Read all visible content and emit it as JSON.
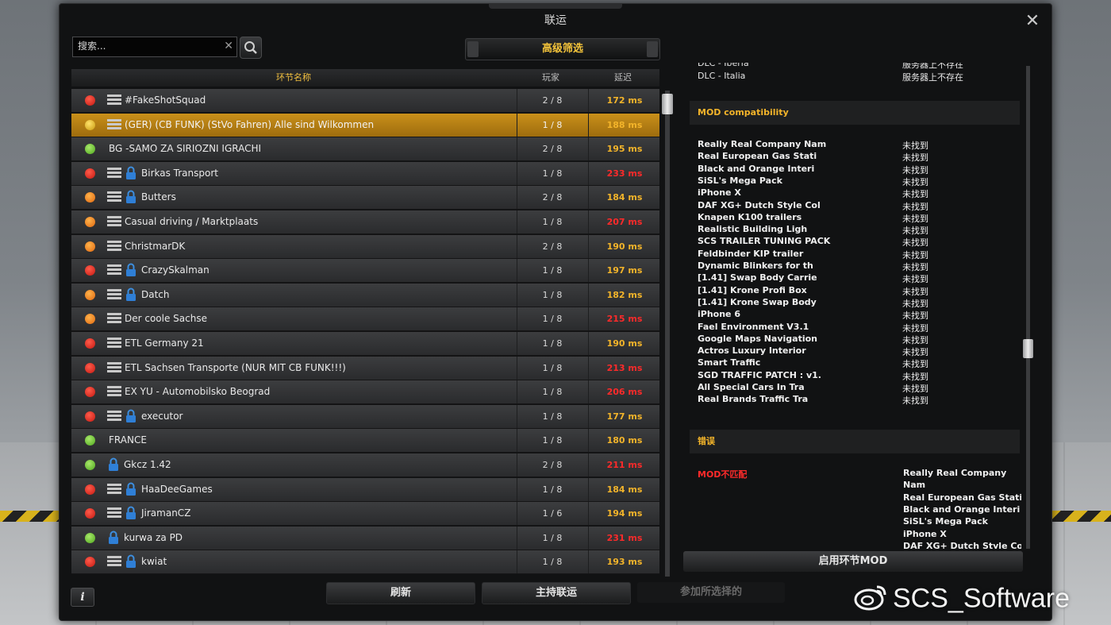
{
  "window": {
    "title": "联运"
  },
  "search": {
    "placeholder": "搜索..."
  },
  "filter": {
    "advanced_label": "高级筛选"
  },
  "list": {
    "headers": {
      "name": "环节名称",
      "players": "玩家",
      "ping": "延迟"
    },
    "rows": [
      {
        "status": "red",
        "icon": "server",
        "locked": false,
        "name": "#FakeShotSquad",
        "players": "2 / 8",
        "ping": "172 ms",
        "ping_level": "warn"
      },
      {
        "status": "yellow",
        "icon": "server",
        "locked": false,
        "name": "(GER) (CB FUNK) (StVo Fahren) Alle sind Wilkommen",
        "players": "1 / 8",
        "ping": "188 ms",
        "ping_level": "warn",
        "selected": true
      },
      {
        "status": "green",
        "icon": "none",
        "locked": false,
        "name": "BG -SAMO ZA SIRIOZNI IGRACHI",
        "players": "2 / 8",
        "ping": "195 ms",
        "ping_level": "warn"
      },
      {
        "status": "red",
        "icon": "server",
        "locked": true,
        "name": "Birkas Transport",
        "players": "1 / 8",
        "ping": "233 ms",
        "ping_level": "bad"
      },
      {
        "status": "orange",
        "icon": "server",
        "locked": true,
        "name": "Butters",
        "players": "2 / 8",
        "ping": "184 ms",
        "ping_level": "warn"
      },
      {
        "status": "orange",
        "icon": "server",
        "locked": false,
        "name": "Casual driving / Marktplaats",
        "players": "1 / 8",
        "ping": "207 ms",
        "ping_level": "bad"
      },
      {
        "status": "orange",
        "icon": "server",
        "locked": false,
        "name": "ChristmarDK",
        "players": "2 / 8",
        "ping": "190 ms",
        "ping_level": "warn"
      },
      {
        "status": "red",
        "icon": "server",
        "locked": true,
        "name": "CrazySkalman",
        "players": "1 / 8",
        "ping": "197 ms",
        "ping_level": "warn"
      },
      {
        "status": "orange",
        "icon": "server",
        "locked": true,
        "name": "Datch",
        "players": "1 / 8",
        "ping": "182 ms",
        "ping_level": "warn"
      },
      {
        "status": "orange",
        "icon": "server",
        "locked": false,
        "name": "Der coole Sachse",
        "players": "1 / 8",
        "ping": "215 ms",
        "ping_level": "bad"
      },
      {
        "status": "red",
        "icon": "server",
        "locked": false,
        "name": "ETL Germany 21",
        "players": "1 / 8",
        "ping": "190 ms",
        "ping_level": "warn"
      },
      {
        "status": "red",
        "icon": "server",
        "locked": false,
        "name": "ETL Sachsen Transporte (NUR MIT CB FUNK!!!)",
        "players": "1 / 8",
        "ping": "213 ms",
        "ping_level": "bad"
      },
      {
        "status": "red",
        "icon": "server",
        "locked": false,
        "name": "EX YU - Automobilsko Beograd",
        "players": "1 / 8",
        "ping": "206 ms",
        "ping_level": "bad"
      },
      {
        "status": "red",
        "icon": "server",
        "locked": true,
        "name": "executor",
        "players": "1 / 8",
        "ping": "177 ms",
        "ping_level": "warn"
      },
      {
        "status": "green",
        "icon": "none",
        "locked": false,
        "name": "FRANCE",
        "players": "1 / 8",
        "ping": "180 ms",
        "ping_level": "warn"
      },
      {
        "status": "green",
        "icon": "none",
        "locked": true,
        "name": "Gkcz 1.42",
        "players": "2 / 8",
        "ping": "211 ms",
        "ping_level": "bad"
      },
      {
        "status": "red",
        "icon": "server",
        "locked": true,
        "name": "HaaDeeGames",
        "players": "1 / 8",
        "ping": "184 ms",
        "ping_level": "warn"
      },
      {
        "status": "red",
        "icon": "server",
        "locked": true,
        "name": "JiramanCZ",
        "players": "1 / 6",
        "ping": "194 ms",
        "ping_level": "warn"
      },
      {
        "status": "green",
        "icon": "none",
        "locked": true,
        "name": "kurwa za PD",
        "players": "1 / 8",
        "ping": "231 ms",
        "ping_level": "bad"
      },
      {
        "status": "red",
        "icon": "server",
        "locked": true,
        "name": "kwiat",
        "players": "1 / 8",
        "ping": "193 ms",
        "ping_level": "warn"
      }
    ]
  },
  "details": {
    "dlc_rows": [
      {
        "name": "DLC - Iberia",
        "status": "服务器上不存在"
      },
      {
        "name": "DLC - Italia",
        "status": "服务器上不存在"
      }
    ],
    "mod_section_title": "MOD compatibility",
    "mods": [
      {
        "name": "Really Real Company Nam",
        "status": "未找到"
      },
      {
        "name": "Real European Gas Stati",
        "status": "未找到"
      },
      {
        "name": "Black and Orange Interi",
        "status": "未找到"
      },
      {
        "name": "SiSL's Mega Pack",
        "status": "未找到"
      },
      {
        "name": "iPhone X",
        "status": "未找到"
      },
      {
        "name": "DAF XG+ Dutch Style Col",
        "status": "未找到"
      },
      {
        "name": "Knapen K100 trailers",
        "status": "未找到"
      },
      {
        "name": "Realistic Building Ligh",
        "status": "未找到"
      },
      {
        "name": "SCS TRAILER TUNING PACK",
        "status": "未找到"
      },
      {
        "name": "Feldbinder KIP trailer",
        "status": "未找到"
      },
      {
        "name": "Dynamic Blinkers for th",
        "status": "未找到"
      },
      {
        "name": "[1.41] Swap Body Carrie",
        "status": "未找到"
      },
      {
        "name": "[1.41] Krone Profi Box",
        "status": "未找到"
      },
      {
        "name": "[1.41] Krone Swap Body",
        "status": "未找到"
      },
      {
        "name": "iPhone 6",
        "status": "未找到"
      },
      {
        "name": "Fael Environment V3.1",
        "status": "未找到"
      },
      {
        "name": "Google Maps Navigation",
        "status": "未找到"
      },
      {
        "name": "Actros Luxury Interior",
        "status": "未找到"
      },
      {
        "name": "Smart Traffic",
        "status": "未找到"
      },
      {
        "name": "SGD TRAFFIC PATCH : v1.",
        "status": "未找到"
      },
      {
        "name": "All Special Cars In Tra",
        "status": "未找到"
      },
      {
        "name": "Real Brands Traffic Tra",
        "status": "未找到"
      }
    ],
    "error_section_title": "错误",
    "error_label": "MOD不匹配",
    "error_items": [
      "Really Real Company",
      "Nam",
      "Real European Gas Stati",
      "Black and Orange Interi",
      "SiSL's Mega Pack",
      "iPhone X",
      "DAF XG+ Dutch Style Col"
    ],
    "enable_mods_label": "启用环节MOD"
  },
  "bottom": {
    "info_label": "i",
    "refresh_label": "刷新",
    "host_label": "主持联运",
    "join_label": "参加所选择的"
  },
  "watermark": {
    "text": "SCS_Software"
  },
  "colors": {
    "accent": "#f3c33a",
    "ping_warn": "#f3b42a",
    "ping_bad": "#ff2a2a",
    "selected_row": "#c9901a",
    "dialog_bg": "#111213"
  }
}
